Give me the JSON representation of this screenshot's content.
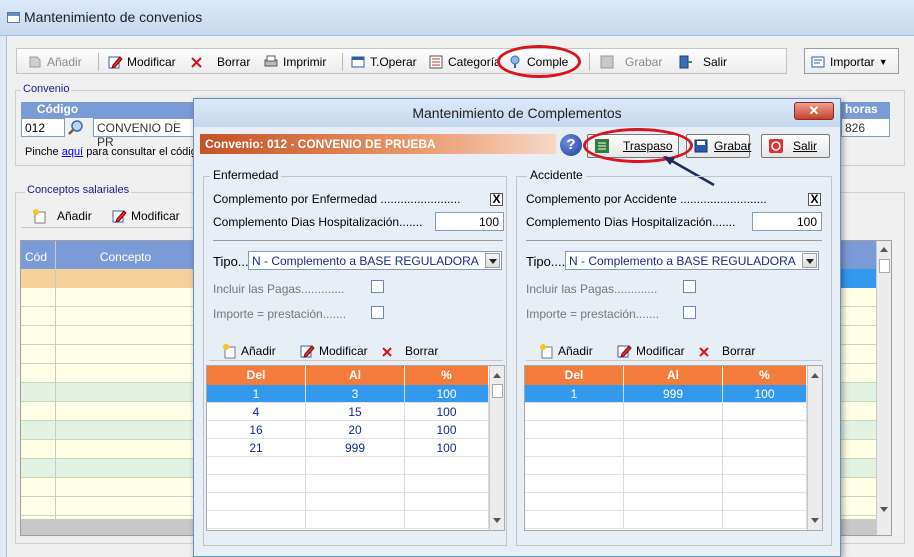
{
  "main_window": {
    "title": "Mantenimiento de convenios",
    "toolbar": {
      "add": "Añadir",
      "modify": "Modificar",
      "delete": "Borrar",
      "print": "Imprimir",
      "toper": "T.Operar",
      "category": "Categoría",
      "comple": "Comple",
      "save": "Grabar",
      "exit": "Salir",
      "import": "Importar"
    },
    "convenio": {
      "group_label": "Convenio",
      "code_header": "Código",
      "hours_header": "horas",
      "code_value": "012",
      "name_value": "CONVENIO DE PR",
      "hours_value": "826",
      "hint_prefix": "Pinche",
      "hint_link": "aquí",
      "hint_suffix": "para consultar el códig"
    },
    "conceptos": {
      "group_label": "Conceptos salariales",
      "add": "Añadir",
      "modify": "Modificar",
      "col_code": "Cód",
      "col_concept": "Concepto"
    }
  },
  "dialog": {
    "title": "Mantenimiento de Complementos",
    "close": "✕",
    "convenio_label": "Convenio: 012 - CONVENIO DE PRUEBA",
    "help": "?",
    "traspaso": "Traspaso",
    "save": "Grabar",
    "exit": "Salir",
    "enfermedad": {
      "title": "Enfermedad",
      "complemento_label": "Complemento por Enfermedad ........................",
      "complemento_checked": "X",
      "dias_label": "Complemento Dias Hospitalización.......",
      "dias_value": "100",
      "tipo_label": "Tipo....",
      "tipo_value": "N - Complemento a BASE REGULADORA",
      "pagas_label": "Incluir las Pagas.............",
      "importe_label": "Importe = prestación.......",
      "add": "Añadir",
      "modify": "Modificar",
      "delete": "Borrar",
      "headers": [
        "Del",
        "Al",
        "%"
      ],
      "rows": [
        [
          "1",
          "3",
          "100"
        ],
        [
          "4",
          "15",
          "100"
        ],
        [
          "16",
          "20",
          "100"
        ],
        [
          "21",
          "999",
          "100"
        ]
      ]
    },
    "accidente": {
      "title": "Accidente",
      "complemento_label": "Complemento por Accidente ..........................",
      "complemento_checked": "X",
      "dias_label": "Complemento Dias Hospitalización.......",
      "dias_value": "100",
      "tipo_label": "Tipo....",
      "tipo_value": "N - Complemento a BASE REGULADORA",
      "pagas_label": "Incluir las Pagas.............",
      "importe_label": "Importe = prestación.......",
      "add": "Añadir",
      "modify": "Modificar",
      "delete": "Borrar",
      "headers": [
        "Del",
        "Al",
        "%"
      ],
      "rows": [
        [
          "1",
          "999",
          "100"
        ]
      ]
    }
  },
  "colors": {
    "accent_orange": "#f37c3d",
    "selected_row": "#3399ee",
    "highlight_red": "#d9141e",
    "header_blue": "#7b9bd6"
  }
}
